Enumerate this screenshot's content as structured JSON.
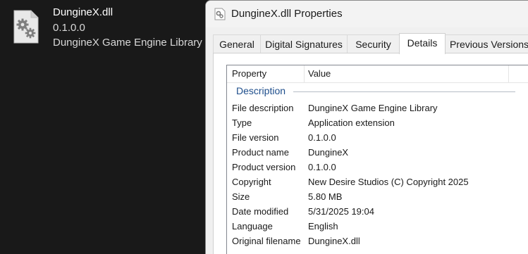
{
  "file_tile": {
    "name": "DungineX.dll",
    "version": "0.1.0.0",
    "description": "DungineX Game Engine Library",
    "icon": "dll-file-gears-icon"
  },
  "dialog": {
    "title": "DungineX.dll Properties",
    "title_icon": "dll-gear-icon",
    "tabs": [
      {
        "label": "General"
      },
      {
        "label": "Digital Signatures"
      },
      {
        "label": "Security"
      },
      {
        "label": "Details",
        "active": true
      },
      {
        "label": "Previous Versions"
      }
    ],
    "details": {
      "columns": {
        "property": "Property",
        "value": "Value"
      },
      "group": "Description",
      "rows": [
        {
          "property": "File description",
          "value": "DungineX Game Engine Library"
        },
        {
          "property": "Type",
          "value": "Application extension"
        },
        {
          "property": "File version",
          "value": "0.1.0.0"
        },
        {
          "property": "Product name",
          "value": "DungineX"
        },
        {
          "property": "Product version",
          "value": "0.1.0.0"
        },
        {
          "property": "Copyright",
          "value": "New Desire Studios (C) Copyright 2025"
        },
        {
          "property": "Size",
          "value": "5.80 MB"
        },
        {
          "property": "Date modified",
          "value": "5/31/2025 19:04"
        },
        {
          "property": "Language",
          "value": "English"
        },
        {
          "property": "Original filename",
          "value": "DungineX.dll"
        }
      ]
    }
  },
  "colors": {
    "desktop_bg": "#191919",
    "dialog_bg": "#f0f0f0",
    "group_header": "#1e4e8c"
  }
}
